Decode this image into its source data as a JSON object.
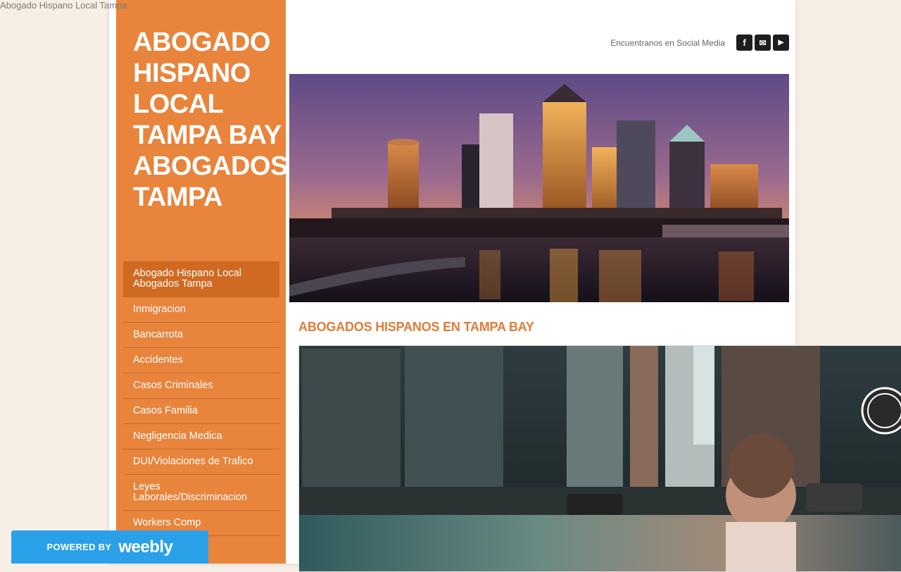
{
  "window": {
    "title": "Abogado Hispano Local Tampa"
  },
  "site": {
    "title_lines": [
      "ABOGADO",
      "HISPANO",
      "LOCAL",
      "TAMPA BAY",
      "ABOGADOS",
      "TAMPA"
    ]
  },
  "nav": {
    "items": [
      {
        "label": "Abogado Hispano Local Abogados Tampa",
        "active": true
      },
      {
        "label": "Inmigracion"
      },
      {
        "label": "Bancarrota"
      },
      {
        "label": "Accidentes"
      },
      {
        "label": "Casos Criminales"
      },
      {
        "label": "Casos Familia"
      },
      {
        "label": "Negligencia Medica"
      },
      {
        "label": "DUI/Violaciones de Trafico"
      },
      {
        "label": "Leyes Laborales/Discriminacion"
      },
      {
        "label": "Workers Comp"
      }
    ]
  },
  "social": {
    "label": "Encuentranos en Social Media",
    "icons": [
      "facebook-icon",
      "mail-icon",
      "youtube-icon"
    ],
    "glyphs": [
      "f",
      "✉",
      "▶"
    ]
  },
  "main": {
    "heading": "ABOGADOS HISPANOS EN TAMPA BAY"
  },
  "footer": {
    "powered_by": "POWERED BY",
    "brand": "weebly"
  },
  "colors": {
    "sidebar": "#e8843c",
    "nav_active": "#d06a22",
    "heading": "#e07b38",
    "badge": "#2aa0e8"
  }
}
